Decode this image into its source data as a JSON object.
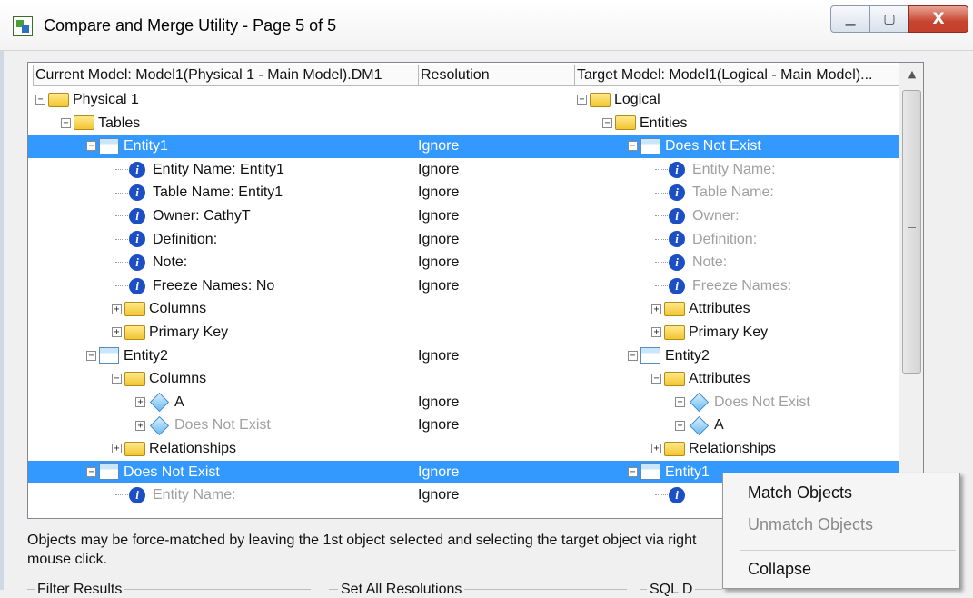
{
  "window": {
    "title": "Compare and Merge Utility  - Page 5 of 5",
    "minimize_glyph": "▁",
    "maximize_glyph": "▢",
    "close_glyph": "X"
  },
  "columns": {
    "current": "Current Model: Model1(Physical 1 - Main Model).DM1",
    "resolution": "Resolution",
    "target": "Target Model: Model1(Logical - Main Model)..."
  },
  "rows": [
    {
      "l": {
        "indent": 8,
        "ex": "−",
        "icon": "folder",
        "text": "Physical 1"
      },
      "res": "",
      "r": {
        "indent": 604,
        "ex": "−",
        "icon": "folder",
        "text": "Logical"
      }
    },
    {
      "l": {
        "indent": 36,
        "ex": "−",
        "icon": "folder",
        "text": "Tables"
      },
      "res": "",
      "r": {
        "indent": 632,
        "ex": "−",
        "icon": "folder",
        "text": "Entities"
      }
    },
    {
      "sel": true,
      "l": {
        "indent": 64,
        "ex": "−",
        "icon": "table",
        "text": "Entity1"
      },
      "res": "Ignore",
      "r": {
        "indent": 660,
        "ex": "−",
        "icon": "table",
        "text": "Does Not Exist"
      }
    },
    {
      "l": {
        "indent": 96,
        "icon": "info",
        "text": "Entity Name: Entity1"
      },
      "res": "Ignore",
      "r": {
        "indent": 690,
        "icon": "info",
        "text": "Entity Name:",
        "dim": true
      }
    },
    {
      "l": {
        "indent": 96,
        "icon": "info",
        "text": "Table Name: Entity1"
      },
      "res": "Ignore",
      "r": {
        "indent": 690,
        "icon": "info",
        "text": "Table Name:",
        "dim": true
      }
    },
    {
      "l": {
        "indent": 96,
        "icon": "info",
        "text": "Owner: CathyT"
      },
      "res": "Ignore",
      "r": {
        "indent": 690,
        "icon": "info",
        "text": "Owner:",
        "dim": true
      }
    },
    {
      "l": {
        "indent": 96,
        "icon": "info",
        "text": "Definition:"
      },
      "res": "Ignore",
      "r": {
        "indent": 690,
        "icon": "info",
        "text": "Definition:",
        "dim": true
      }
    },
    {
      "l": {
        "indent": 96,
        "icon": "info",
        "text": "Note:"
      },
      "res": "Ignore",
      "r": {
        "indent": 690,
        "icon": "info",
        "text": "Note:",
        "dim": true
      }
    },
    {
      "l": {
        "indent": 96,
        "icon": "info",
        "text": "Freeze Names: No"
      },
      "res": "Ignore",
      "r": {
        "indent": 690,
        "icon": "info",
        "text": "Freeze Names:",
        "dim": true
      }
    },
    {
      "l": {
        "indent": 92,
        "ex": "+",
        "icon": "folder",
        "text": "Columns"
      },
      "res": "",
      "r": {
        "indent": 686,
        "ex": "+",
        "icon": "folder",
        "text": "Attributes"
      }
    },
    {
      "l": {
        "indent": 92,
        "ex": "+",
        "icon": "folder",
        "text": "Primary Key"
      },
      "res": "",
      "r": {
        "indent": 686,
        "ex": "+",
        "icon": "folder",
        "text": "Primary Key"
      }
    },
    {
      "l": {
        "indent": 64,
        "ex": "−",
        "icon": "table",
        "text": "Entity2"
      },
      "res": "Ignore",
      "r": {
        "indent": 660,
        "ex": "−",
        "icon": "table",
        "text": "Entity2"
      }
    },
    {
      "l": {
        "indent": 92,
        "ex": "−",
        "icon": "folder",
        "text": "Columns"
      },
      "res": "",
      "r": {
        "indent": 686,
        "ex": "−",
        "icon": "folder",
        "text": "Attributes"
      }
    },
    {
      "l": {
        "indent": 118,
        "ex": "+",
        "icon": "diamond",
        "text": "A"
      },
      "res": "Ignore",
      "r": {
        "indent": 712,
        "ex": "+",
        "icon": "diamond",
        "text": "Does Not Exist",
        "dim": true
      }
    },
    {
      "l": {
        "indent": 118,
        "ex": "+",
        "icon": "diamond",
        "text": "Does Not Exist",
        "dim": true
      },
      "res": "Ignore",
      "r": {
        "indent": 712,
        "ex": "+",
        "icon": "diamond",
        "text": "A"
      }
    },
    {
      "l": {
        "indent": 92,
        "ex": "+",
        "icon": "folder",
        "text": "Relationships"
      },
      "res": "",
      "r": {
        "indent": 686,
        "ex": "+",
        "icon": "folder",
        "text": "Relationships"
      }
    },
    {
      "sel": true,
      "l": {
        "indent": 64,
        "ex": "−",
        "icon": "table",
        "text": "Does Not Exist"
      },
      "res": "Ignore",
      "r": {
        "indent": 660,
        "ex": "−",
        "icon": "table",
        "text": "Entity1"
      }
    },
    {
      "l": {
        "indent": 96,
        "icon": "info",
        "text": "Entity Name:",
        "dim": true
      },
      "res": "Ignore",
      "r": {
        "indent": 690,
        "icon": "info",
        "text": ""
      }
    }
  ],
  "help_text": "Objects may be force-matched by leaving the 1st object selected and selecting the target object via right mouse click.",
  "groups": {
    "filter": "Filter Results",
    "resolutions": "Set All Resolutions",
    "sql": "SQL D"
  },
  "context_menu": {
    "match": "Match Objects",
    "unmatch": "Unmatch Objects",
    "collapse": "Collapse"
  },
  "colors": {
    "selection": "#3399ff",
    "folder": "#f2c531",
    "info": "#1d4fc4",
    "close_button": "#c7452f"
  }
}
